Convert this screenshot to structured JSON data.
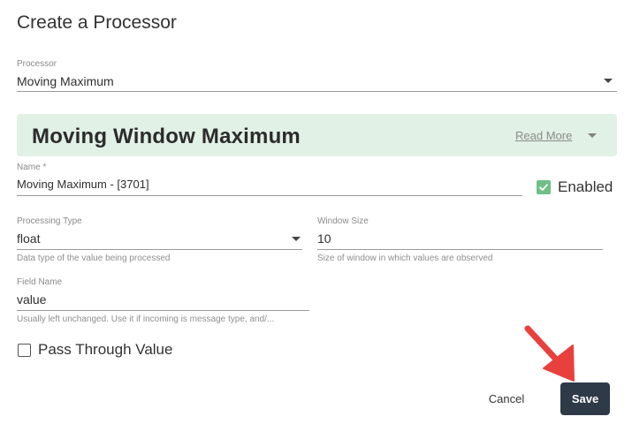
{
  "dialog": {
    "title": "Create a Processor"
  },
  "processor_field": {
    "label": "Processor",
    "value": "Moving Maximum"
  },
  "banner": {
    "title": "Moving Window Maximum",
    "read_more": "Read More"
  },
  "name_field": {
    "label": "Name *",
    "value": "Moving Maximum  - [3701]"
  },
  "enabled": {
    "label": "Enabled",
    "checked": true
  },
  "processing_type_field": {
    "label": "Processing Type",
    "value": "float",
    "helper": "Data type of the value being processed"
  },
  "window_size_field": {
    "label": "Window Size",
    "value": "10",
    "helper": "Size of window in which values are observed"
  },
  "field_name_field": {
    "label": "Field Name",
    "value": "value",
    "helper": "Usually left unchanged. Use it if incoming is message type, and/..."
  },
  "pass_through": {
    "label": "Pass Through Value",
    "checked": false
  },
  "actions": {
    "cancel_label": "Cancel",
    "save_label": "Save"
  },
  "colors": {
    "banner_bg": "#e1f1e5",
    "checkbox_checked": "#6fbf86",
    "save_button": "#2e3a48",
    "annotation_arrow": "#e8403d"
  },
  "icons": {
    "processor_dropdown": "chevron-down-icon",
    "read_more_toggle": "chevron-down-icon",
    "enabled_checkbox": "check-icon",
    "processing_type_dropdown": "chevron-down-icon",
    "annotation": "arrow-annotation-icon"
  }
}
